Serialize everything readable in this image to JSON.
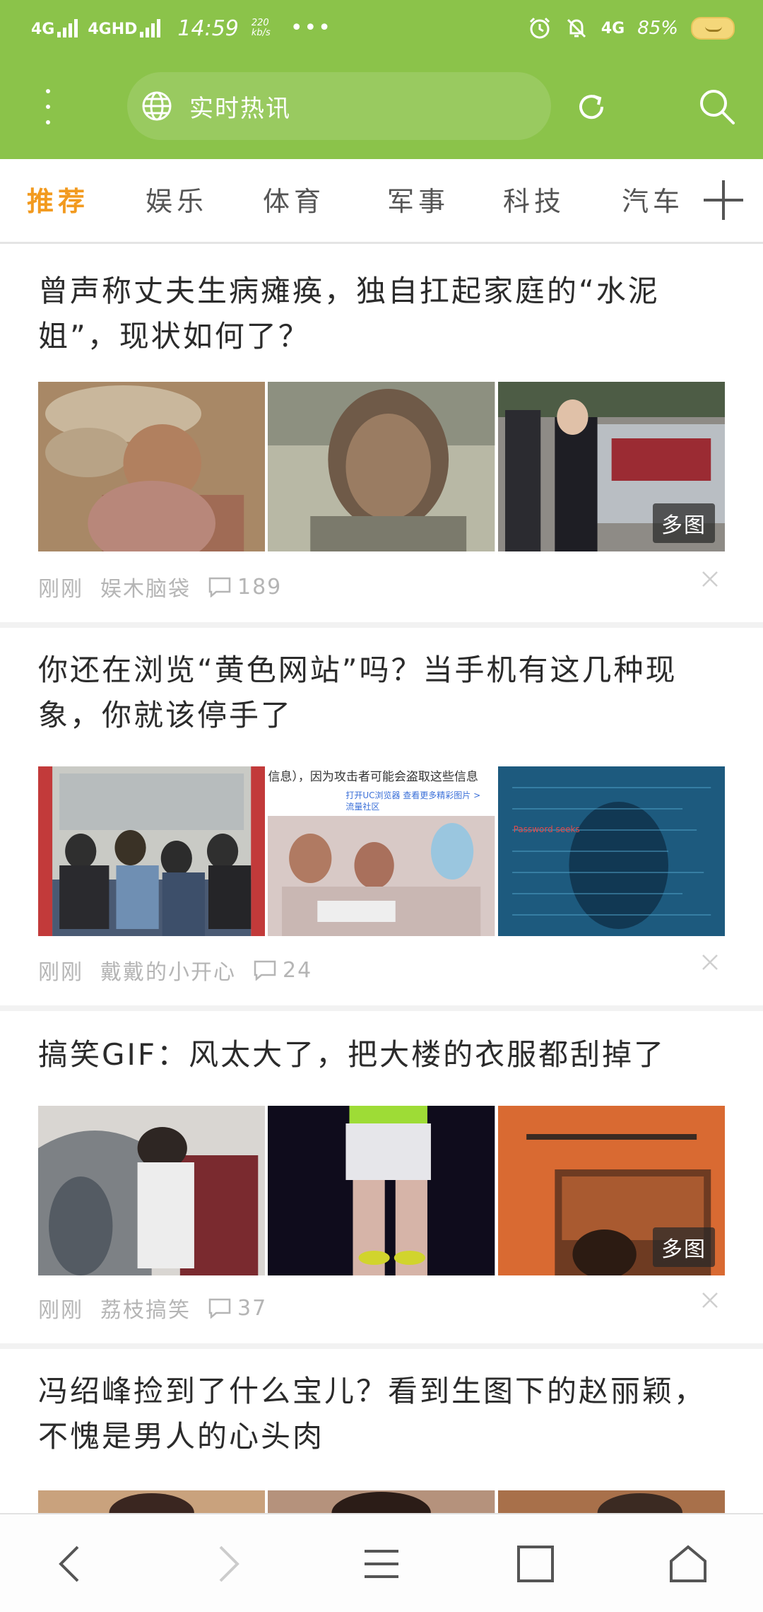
{
  "status_bar": {
    "network_1": "4G",
    "network_2": "4GHD",
    "time": "14:59",
    "speed_value": "220",
    "speed_unit": "kb/s",
    "more": "•••",
    "icons": [
      "alarm-icon",
      "mute-icon"
    ],
    "network_right": "4G",
    "battery_percent": "85%"
  },
  "search": {
    "placeholder": "实时热讯",
    "globe_icon": "globe-icon",
    "refresh_icon": "refresh-icon",
    "search_icon": "search-icon",
    "menu_icon": "vertical-dots-icon"
  },
  "tabs": [
    {
      "label": "推荐",
      "active": true
    },
    {
      "label": "娱乐",
      "active": false
    },
    {
      "label": "体育",
      "active": false
    },
    {
      "label": "军事",
      "active": false
    },
    {
      "label": "科技",
      "active": false
    },
    {
      "label": "汽车",
      "active": false
    }
  ],
  "articles": [
    {
      "title": "曾声称丈夫生病瘫痪，独自扛起家庭的“水泥姐”，现状如何了？",
      "time": "刚刚",
      "source": "娱木脑袋",
      "comments": "189",
      "badge": "多图"
    },
    {
      "title": "你还在浏览“黄色网站”吗？当手机有这几种现象，你就该停手了",
      "time": "刚刚",
      "source": "戴戴的小开心",
      "comments": "24",
      "badge": "",
      "thumb_text_1": "信息），因为攻击者可能会盗取这些信息",
      "thumb_text_2": "打开UC浏览器 查看更多精彩图片 >",
      "thumb_text_3": "流量社区",
      "thumb_text_4": "Password seeks"
    },
    {
      "title": "搞笑GIF：风太大了，把大楼的衣服都刮掉了",
      "time": "刚刚",
      "source": "荔枝搞笑",
      "comments": "37",
      "badge": "多图"
    },
    {
      "title": "冯绍峰捡到了什么宝儿？看到生图下的赵丽颖，不愧是男人的心头肉"
    }
  ],
  "colors": {
    "header_green": "#8bc34a",
    "active_tab": "#f29a1f",
    "meta_gray": "#b5b5b5"
  },
  "bottom_nav": [
    "back-icon",
    "forward-icon",
    "menu-icon",
    "tabs-icon",
    "home-icon"
  ]
}
